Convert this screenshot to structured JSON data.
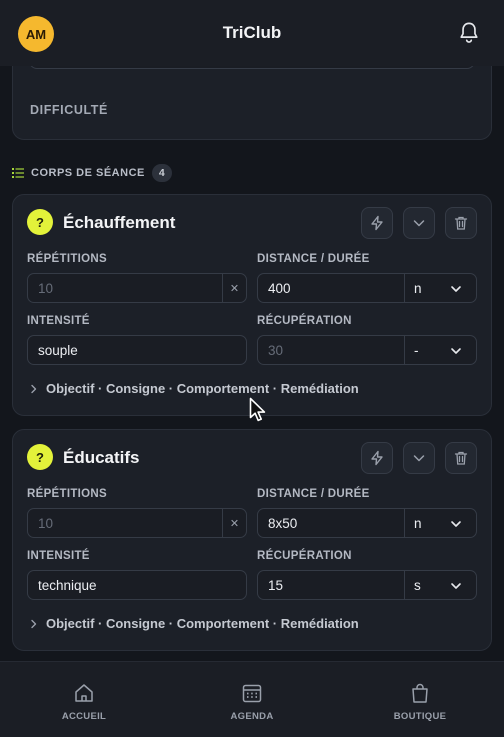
{
  "header": {
    "avatar_initials": "AM",
    "title": "TriClub",
    "notification_icon": "bell-icon"
  },
  "top_card": {
    "difficulty_label": "DIFFICULTÉ"
  },
  "section": {
    "label": "CORPS DE SÉANCE",
    "count": "4"
  },
  "blocks": [
    {
      "badge": "?",
      "title": "Échauffement",
      "repetitions_label": "RÉPÉTITIONS",
      "repetitions_placeholder": "10",
      "distance_label": "DISTANCE / DURÉE",
      "distance_value": "400",
      "distance_unit": "n",
      "intensity_label": "INTENSITÉ",
      "intensity_value": "souple",
      "recovery_label": "RÉCUPÉRATION",
      "recovery_placeholder": "30",
      "recovery_unit": "-",
      "expander_label": "Objectif · Consigne · Comportement · Remédiation"
    },
    {
      "badge": "?",
      "title": "Éducatifs",
      "repetitions_label": "RÉPÉTITIONS",
      "repetitions_placeholder": "10",
      "distance_label": "DISTANCE / DURÉE",
      "distance_value": "8x50",
      "distance_unit": "n",
      "intensity_label": "INTENSITÉ",
      "intensity_value": "technique",
      "recovery_label": "RÉCUPÉRATION",
      "recovery_value": "15",
      "recovery_unit": "s",
      "expander_label": "Objectif · Consigne · Comportement · Remédiation"
    }
  ],
  "nav": [
    {
      "label": "ACCUEIL",
      "icon": "home-icon"
    },
    {
      "label": "AGENDA",
      "icon": "calendar-icon"
    },
    {
      "label": "BOUTIQUE",
      "icon": "shopping-bag-icon"
    }
  ],
  "colors": {
    "accent_yellow": "#e3f23a",
    "avatar": "#f5b82e",
    "background": "#13161c",
    "card": "#1c2028"
  }
}
